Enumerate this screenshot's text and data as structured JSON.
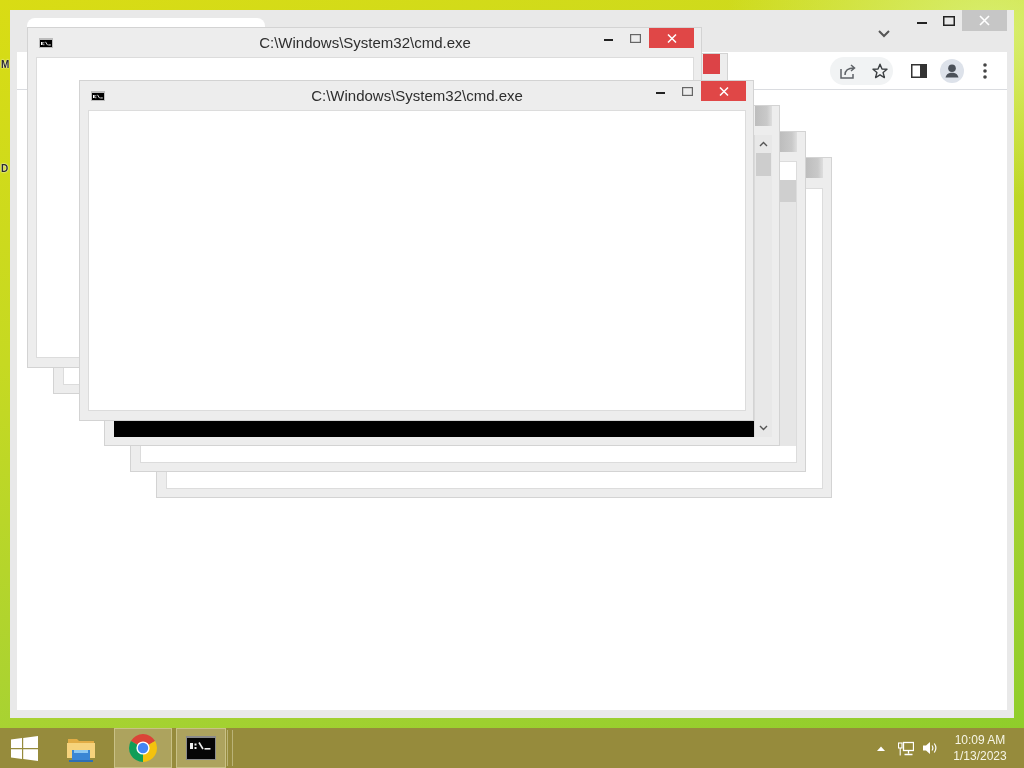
{
  "desktop": {
    "icon_labels": [
      "M",
      "D"
    ]
  },
  "windows": [
    {
      "title": "C:\\Windows\\System32\\cmd.exe"
    },
    {
      "title": "C:\\Windows\\System32\\cmd.exe"
    }
  ],
  "taskbar": {
    "apps": [
      {
        "kind": "explorer",
        "running": false
      },
      {
        "kind": "browser",
        "running": true
      },
      {
        "kind": "terminal",
        "running": true
      }
    ],
    "clock": {
      "time": "10:09 AM",
      "date": "1/13/2023"
    }
  }
}
